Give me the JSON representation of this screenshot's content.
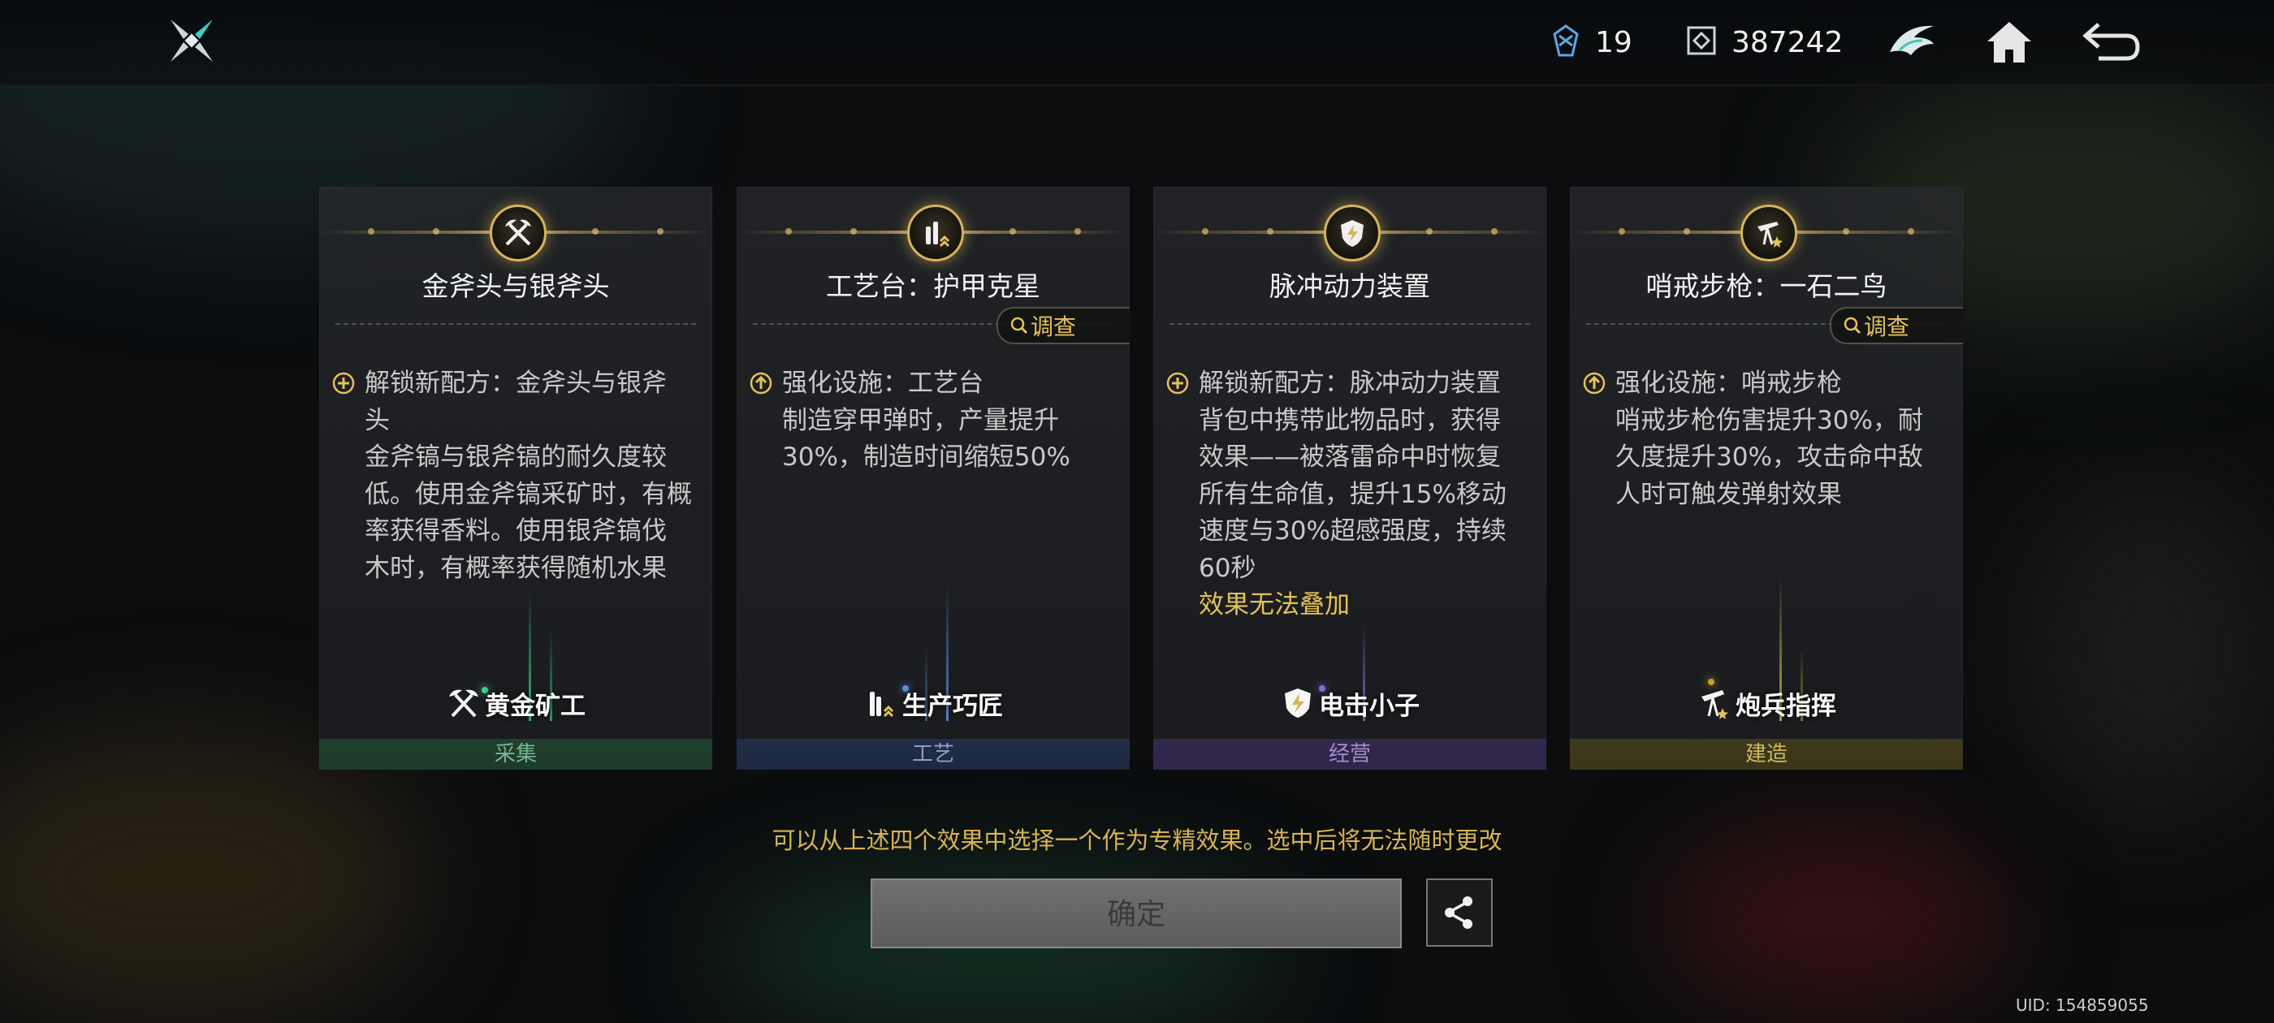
{
  "topbar": {
    "logo_icon": "crossed-blades-logo-icon",
    "resources": [
      {
        "icon": "crystal-chip-icon",
        "value": "19"
      },
      {
        "icon": "cube-currency-icon",
        "value": "387242"
      }
    ],
    "buttons": [
      "emblem-icon",
      "home-icon",
      "back-icon"
    ]
  },
  "cards": [
    {
      "icon": "crossed-pickaxes-icon",
      "title": "金斧头与银斧头",
      "has_invest": false,
      "desc_first": "解锁新配方：金斧头与银斧",
      "desc_lines": [
        "头",
        "金斧镐与银斧镐的耐久度较",
        "低。使用金斧镐采矿时，有概",
        "率获得香料。使用银斧镐伐",
        "木时，有概率获得随机水果"
      ],
      "warning": "",
      "badge_name": "黄金矿工",
      "category": "采集",
      "accent": "#3fd08a"
    },
    {
      "icon": "bullets-upgrade-icon",
      "title": "工艺台：护甲克星",
      "has_invest": true,
      "invest_label": "调查",
      "desc_first": "强化设施：工艺台",
      "desc_lines": [
        "制造穿甲弹时，产量提升",
        "30%，制造时间缩短50%"
      ],
      "warning": "",
      "badge_name": "生产巧匠",
      "category": "工艺",
      "accent": "#5a8ee0"
    },
    {
      "icon": "shield-bolt-icon",
      "title": "脉冲动力装置",
      "has_invest": false,
      "desc_first": "解锁新配方：脉冲动力装置",
      "desc_lines": [
        "背包中携带此物品时，获得",
        "效果——被落雷命中时恢复",
        "所有生命值，提升15%移动",
        "速度与30%超感强度，持续",
        "60秒"
      ],
      "warning": "效果无法叠加",
      "badge_name": "电击小子",
      "category": "经营",
      "accent": "#8a6ad8"
    },
    {
      "icon": "sentry-rifle-icon",
      "title": "哨戒步枪：一石二鸟",
      "has_invest": true,
      "invest_label": "调查",
      "desc_first": "强化设施：哨戒步枪",
      "desc_lines": [
        "哨戒步枪伤害提升30%，耐",
        "久度提升30%，攻击命中敌",
        "人时可触发弹射效果"
      ],
      "warning": "",
      "badge_name": "炮兵指挥",
      "category": "建造",
      "accent": "#d6b640"
    }
  ],
  "hint": "可以从上述四个效果中选择一个作为专精效果。选中后将无法随时更改",
  "confirm_label": "确定",
  "share_icon": "share-icon",
  "uid": "UID: 154859055"
}
